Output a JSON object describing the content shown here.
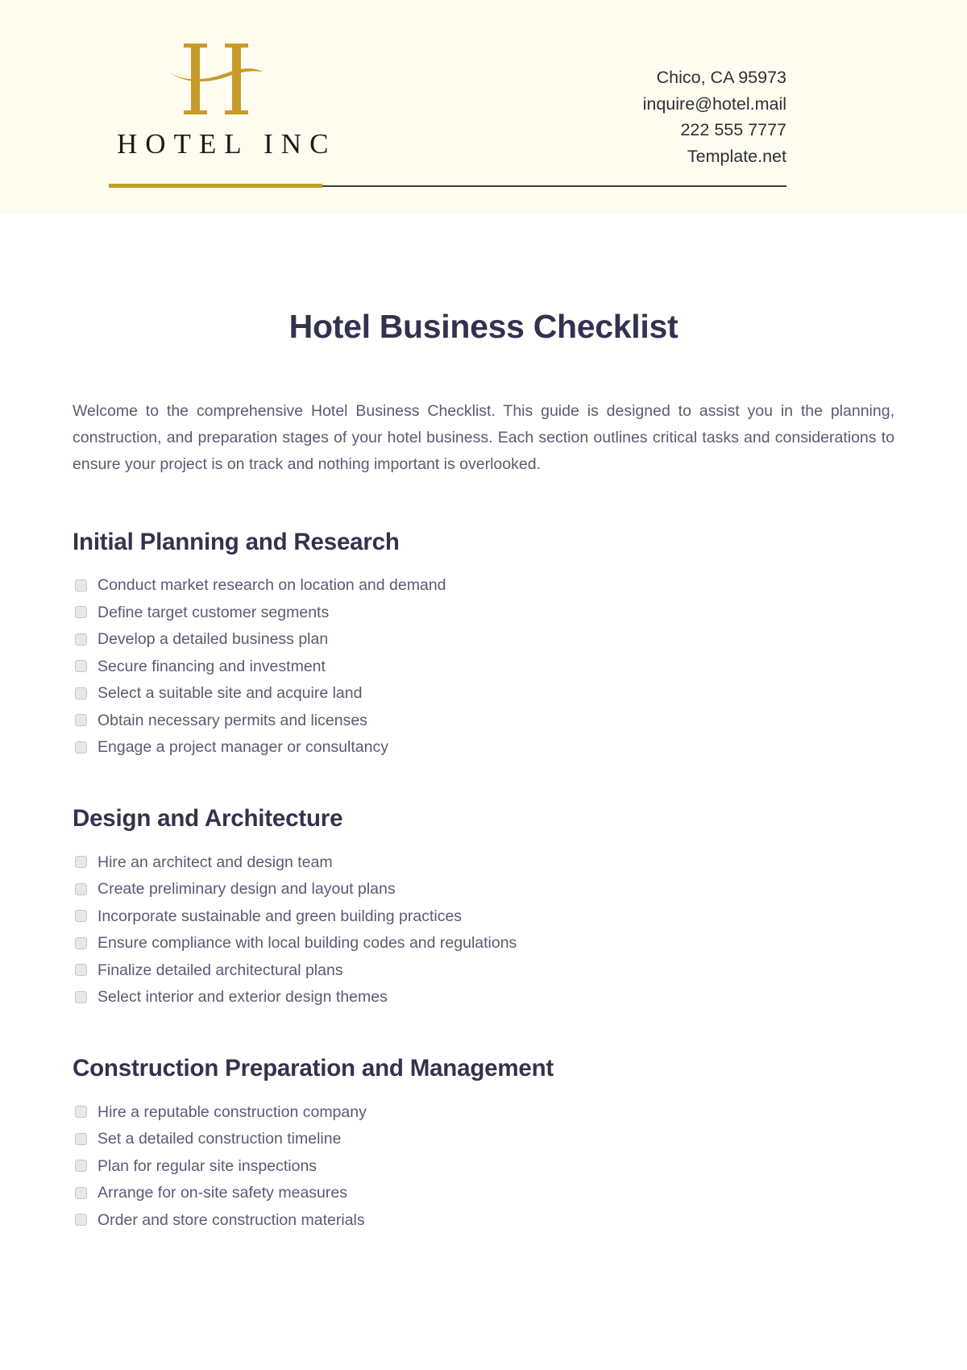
{
  "brand": {
    "monogram_letter": "H",
    "wordmark": "HOTEL INC",
    "gold": "#c79a2b",
    "band_background": "#fefcef"
  },
  "contact": {
    "lines": [
      "Chico, CA 95973",
      "inquire@hotel.mail",
      "222 555 7777",
      "Template.net"
    ]
  },
  "document": {
    "title": "Hotel Business Checklist",
    "intro": "Welcome to the comprehensive Hotel Business Checklist. This guide is designed to assist you in the planning, construction, and preparation stages of your hotel business. Each section outlines critical tasks and considerations to ensure your project is on track and nothing important is overlooked.",
    "heading_color": "#33324e",
    "body_color": "#5b5a72"
  },
  "sections": [
    {
      "heading": "Initial Planning and Research",
      "items": [
        "Conduct market research on location and demand",
        "Define target customer segments",
        "Develop a detailed business plan",
        "Secure financing and investment",
        "Select a suitable site and acquire land",
        "Obtain necessary permits and licenses",
        "Engage a project manager or consultancy"
      ]
    },
    {
      "heading": "Design and Architecture",
      "items": [
        "Hire an architect and design team",
        "Create preliminary design and layout plans",
        "Incorporate sustainable and green building practices",
        "Ensure compliance with local building codes and regulations",
        "Finalize detailed architectural plans",
        "Select interior and exterior design themes"
      ]
    },
    {
      "heading": "Construction Preparation and Management",
      "items": [
        "Hire a reputable construction company",
        "Set a detailed construction timeline",
        "Plan for regular site inspections",
        "Arrange for on-site safety measures",
        "Order and store construction materials"
      ]
    }
  ]
}
